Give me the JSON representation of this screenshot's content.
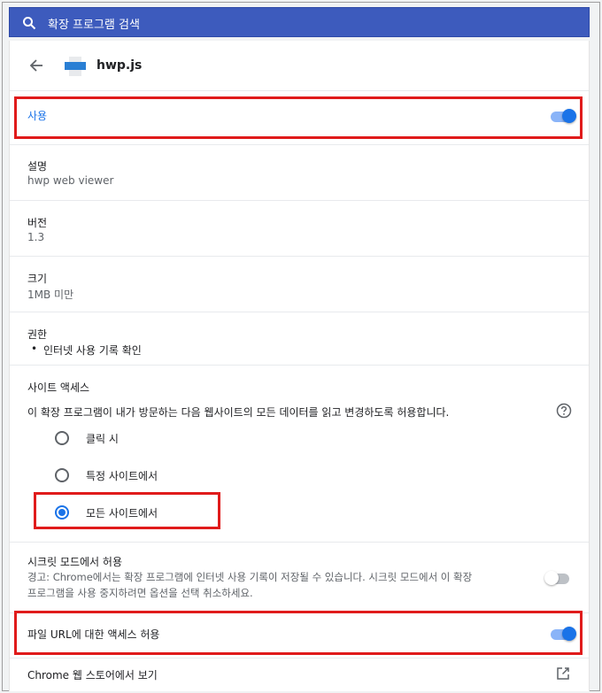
{
  "search": {
    "placeholder": "확장 프로그램 검색"
  },
  "extension": {
    "name": "hwp.js",
    "icon_text": "HWP.JS"
  },
  "enabled": {
    "label": "사용",
    "on": true
  },
  "description": {
    "label": "설명",
    "value": "hwp web viewer"
  },
  "version": {
    "label": "버전",
    "value": "1.3"
  },
  "size": {
    "label": "크기",
    "value": "1MB 미만"
  },
  "permissions": {
    "label": "권한",
    "items": [
      "인터넷 사용 기록 확인"
    ]
  },
  "site_access": {
    "label": "사이트 액세스",
    "description": "이 확장 프로그램이 내가 방문하는 다음 웹사이트의 모든 데이터를 읽고 변경하도록 허용합니다.",
    "options": [
      "클릭 시",
      "특정 사이트에서",
      "모든 사이트에서"
    ],
    "selected": "모든 사이트에서"
  },
  "incognito": {
    "label": "시크릿 모드에서 허용",
    "warning_line1": "경고: Chrome에서는 확장 프로그램에 인터넷 사용 기록이 저장될 수 있습니다. 시크릿 모드에서 이 확장",
    "warning_line2": "프로그램을 사용 중지하려면 옵션을 선택 취소하세요.",
    "on": false
  },
  "file_urls": {
    "label": "파일 URL에 대한 액세스 허용",
    "on": true
  },
  "web_store": {
    "label": "Chrome 웹 스토어에서 보기"
  },
  "colors": {
    "accent": "#1a73e8",
    "topbar": "#3d5bbd",
    "highlight": "#e01b1b"
  }
}
